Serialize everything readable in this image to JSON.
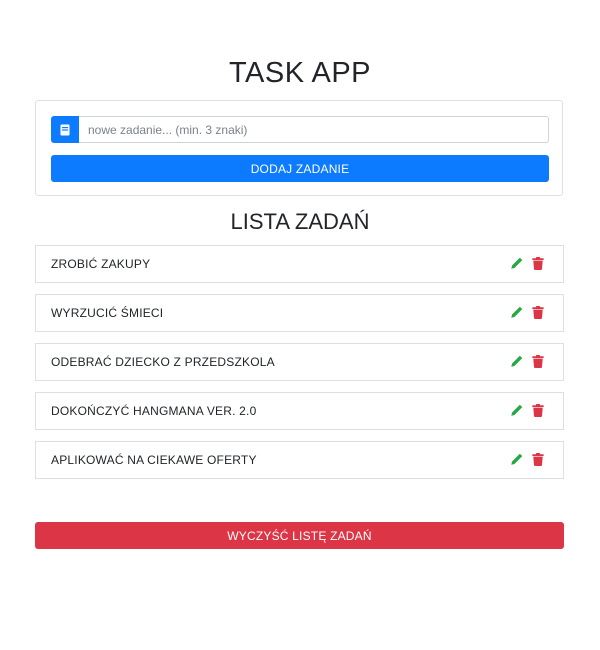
{
  "app": {
    "title": "TASK APP"
  },
  "form": {
    "input_icon": "note-icon",
    "input_value": "",
    "input_placeholder": "nowe zadanie... (min. 3 znaki)",
    "add_button_label": "DODAJ ZADANIE"
  },
  "list": {
    "title": "LISTA ZADAŃ",
    "items": [
      {
        "label": "ZROBIĆ ZAKUPY",
        "edit_icon": "pencil-icon",
        "delete_icon": "trash-icon"
      },
      {
        "label": "WYRZUCIĆ ŚMIECI",
        "edit_icon": "pencil-icon",
        "delete_icon": "trash-icon"
      },
      {
        "label": "ODEBRAĆ DZIECKO Z PRZEDSZKOLA",
        "edit_icon": "pencil-icon",
        "delete_icon": "trash-icon"
      },
      {
        "label": "DOKOŃCZYĆ HANGMANA VER. 2.0",
        "edit_icon": "pencil-icon",
        "delete_icon": "trash-icon"
      },
      {
        "label": "APLIKOWAĆ NA CIEKAWE OFERTY",
        "edit_icon": "pencil-icon",
        "delete_icon": "trash-icon"
      }
    ]
  },
  "clear_button_label": "WYCZYŚĆ LISTĘ ZADAŃ",
  "colors": {
    "primary": "#0d7bff",
    "danger": "#dc3545",
    "success": "#28a745"
  }
}
